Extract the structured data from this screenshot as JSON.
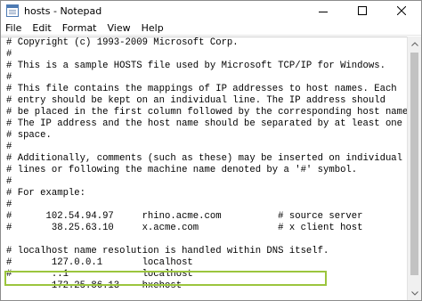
{
  "window": {
    "title": "hosts - Notepad",
    "icon": "notepad-icon",
    "controls": [
      "minimize-icon",
      "maximize-icon",
      "close-icon"
    ]
  },
  "menu": {
    "items": [
      {
        "label": "File"
      },
      {
        "label": "Edit"
      },
      {
        "label": "Format"
      },
      {
        "label": "View"
      },
      {
        "label": "Help"
      }
    ]
  },
  "document": {
    "lines": [
      "# Copyright (c) 1993-2009 Microsoft Corp.",
      "#",
      "# This is a sample HOSTS file used by Microsoft TCP/IP for Windows.",
      "#",
      "# This file contains the mappings of IP addresses to host names. Each",
      "# entry should be kept on an individual line. The IP address should",
      "# be placed in the first column followed by the corresponding host name.",
      "# The IP address and the host name should be separated by at least one",
      "# space.",
      "#",
      "# Additionally, comments (such as these) may be inserted on individual",
      "# lines or following the machine name denoted by a '#' symbol.",
      "#",
      "# For example:",
      "#",
      "#      102.54.94.97     rhino.acme.com          # source server",
      "#       38.25.63.10     x.acme.com              # x client host",
      "",
      "# localhost name resolution is handled within DNS itself.",
      "#\t127.0.0.1       localhost",
      "#\t::1             localhost",
      "\t172.25.86.13\thxehost"
    ],
    "highlighted_line": "\t172.25.86.13\thxehost"
  },
  "colors": {
    "highlight_border": "#9bc53d",
    "scrollbar_thumb": "#c2c2c2"
  }
}
